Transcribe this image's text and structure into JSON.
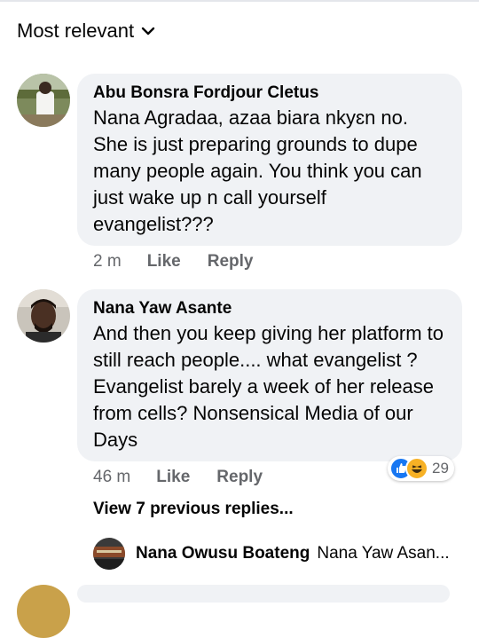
{
  "sort": {
    "label": "Most relevant",
    "icon": "chevron-down-icon"
  },
  "comments": [
    {
      "author": "Abu Bonsra Fordjour Cletus",
      "text": "Nana Agradaa, azaa biara nkyɛn no. She is just preparing grounds to dupe many people again. You think you can just wake up n call yourself evangelist???",
      "time": "2 m",
      "like_label": "Like",
      "reply_label": "Reply"
    },
    {
      "author": "Nana Yaw Asante",
      "text": "And then you keep giving her platform to still reach people.... what evangelist ? Evangelist barely a week of her release from cells? Nonsensical Media of our Days",
      "time": "46 m",
      "like_label": "Like",
      "reply_label": "Reply",
      "reaction_count": "29",
      "reaction_icons": [
        "like-icon",
        "haha-icon"
      ]
    }
  ],
  "replies": {
    "view_label": "View 7 previous replies...",
    "preview_author": "Nana Owusu Boateng",
    "preview_text": "Nana Yaw Asan..."
  },
  "colors": {
    "bubble": "#f0f2f5",
    "secondary_text": "#65676b",
    "like_blue": "#1877f2",
    "haha_yellow": "#f7b125"
  }
}
